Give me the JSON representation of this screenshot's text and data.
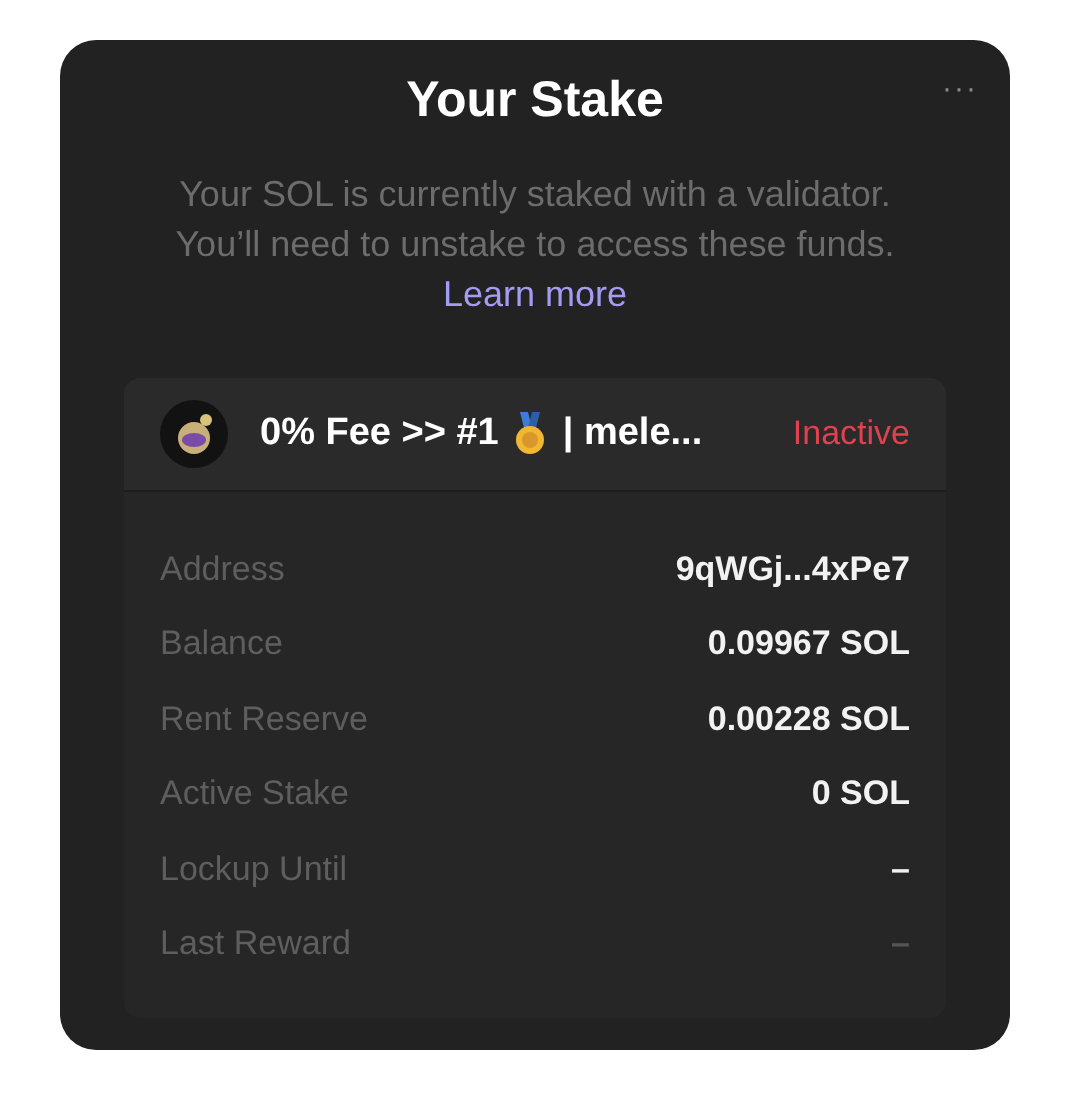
{
  "title": "Your Stake",
  "menu_icon": "···",
  "description": {
    "text": "Your SOL is currently staked with a validator. You’ll need to unstake to access these funds.",
    "link": "Learn more"
  },
  "validator": {
    "name_start": "0% Fee >> #1",
    "name_end": "| mele...",
    "status": "Inactive"
  },
  "details": [
    {
      "label": "Address",
      "value": "9qWGj...4xPe7",
      "muted": false
    },
    {
      "label": "Balance",
      "value": "0.09967 SOL",
      "muted": false
    },
    {
      "label": "Rent Reserve",
      "value": "0.00228 SOL",
      "muted": false
    },
    {
      "label": "Active Stake",
      "value": "0 SOL",
      "muted": false
    },
    {
      "label": "Lockup Until",
      "value": "–",
      "muted": false
    },
    {
      "label": "Last Reward",
      "value": "–",
      "muted": true
    }
  ]
}
